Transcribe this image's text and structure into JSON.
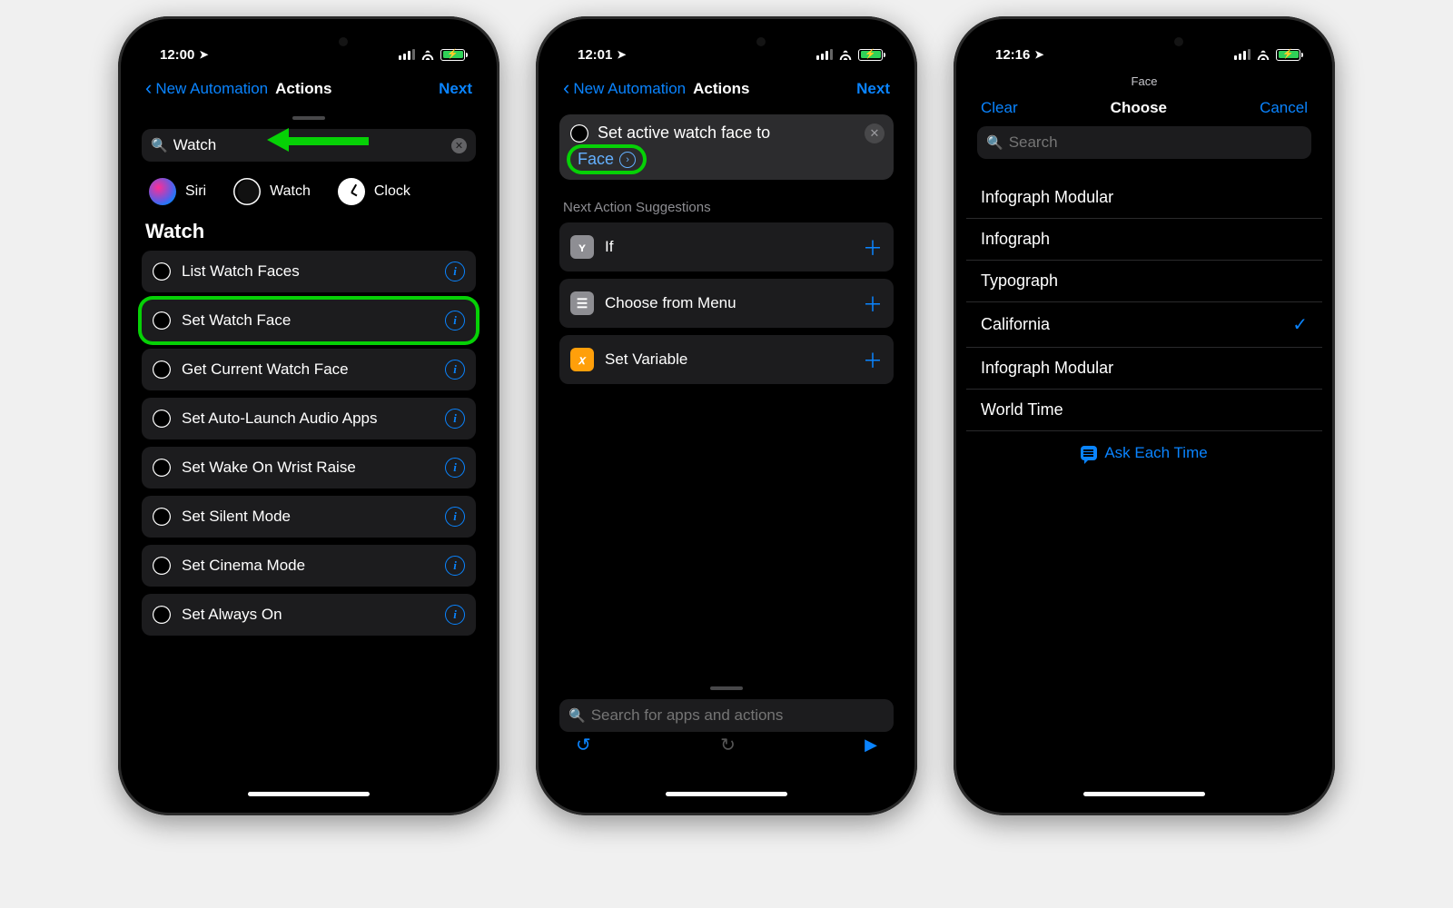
{
  "colors": {
    "accent": "#0a84ff",
    "highlight": "#06d106",
    "battery": "#30d158"
  },
  "screen1": {
    "time": "12:00",
    "nav": {
      "back": "New Automation",
      "title": "Actions",
      "next": "Next"
    },
    "search": {
      "value": "Watch"
    },
    "apps": [
      {
        "icon": "siri-icon",
        "label": "Siri"
      },
      {
        "icon": "watch-icon",
        "label": "Watch"
      },
      {
        "icon": "clock-icon",
        "label": "Clock"
      }
    ],
    "section_title": "Watch",
    "actions": [
      {
        "label": "List Watch Faces",
        "highlighted": false
      },
      {
        "label": "Set Watch Face",
        "highlighted": true
      },
      {
        "label": "Get Current Watch Face",
        "highlighted": false
      },
      {
        "label": "Set Auto-Launch Audio Apps",
        "highlighted": false
      },
      {
        "label": "Set Wake On Wrist Raise",
        "highlighted": false
      },
      {
        "label": "Set Silent Mode",
        "highlighted": false
      },
      {
        "label": "Set Cinema Mode",
        "highlighted": false
      },
      {
        "label": "Set Always On",
        "highlighted": false
      }
    ]
  },
  "screen2": {
    "time": "12:01",
    "nav": {
      "back": "New Automation",
      "title": "Actions",
      "next": "Next"
    },
    "action": {
      "prefix": "Set active watch face to",
      "param": "Face"
    },
    "suggestions_header": "Next Action Suggestions",
    "suggestions": [
      {
        "label": "If",
        "icon": "branch-icon"
      },
      {
        "label": "Choose from Menu",
        "icon": "menu-icon"
      },
      {
        "label": "Set Variable",
        "icon": "variable-icon"
      }
    ],
    "search_placeholder": "Search for apps and actions"
  },
  "screen3": {
    "time": "12:16",
    "header_mini": "Face",
    "nav": {
      "clear": "Clear",
      "title": "Choose",
      "cancel": "Cancel"
    },
    "search_placeholder": "Search",
    "faces": [
      {
        "label": "Infograph Modular",
        "selected": false
      },
      {
        "label": "Infograph",
        "selected": false
      },
      {
        "label": "Typograph",
        "selected": false
      },
      {
        "label": "California",
        "selected": true
      },
      {
        "label": "Infograph Modular",
        "selected": false
      },
      {
        "label": "World Time",
        "selected": false
      }
    ],
    "ask_each_time": "Ask Each Time"
  }
}
